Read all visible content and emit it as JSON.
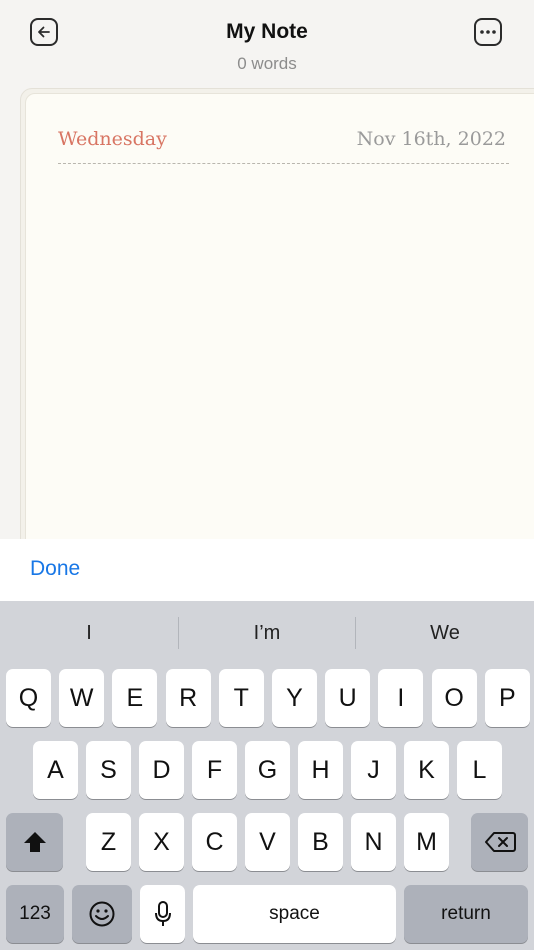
{
  "header": {
    "title": "My Note",
    "word_count": "0 words"
  },
  "note": {
    "weekday": "Wednesday",
    "date": "Nov 16th, 2022"
  },
  "toolbar": {
    "done_label": "Done"
  },
  "keyboard": {
    "suggestions": [
      "I",
      "I’m",
      "We"
    ],
    "row1": [
      "Q",
      "W",
      "E",
      "R",
      "T",
      "Y",
      "U",
      "I",
      "O",
      "P"
    ],
    "row2": [
      "A",
      "S",
      "D",
      "F",
      "G",
      "H",
      "J",
      "K",
      "L"
    ],
    "row3": [
      "Z",
      "X",
      "C",
      "V",
      "B",
      "N",
      "M"
    ],
    "numbers_label": "123",
    "space_label": "space",
    "return_label": "return"
  }
}
